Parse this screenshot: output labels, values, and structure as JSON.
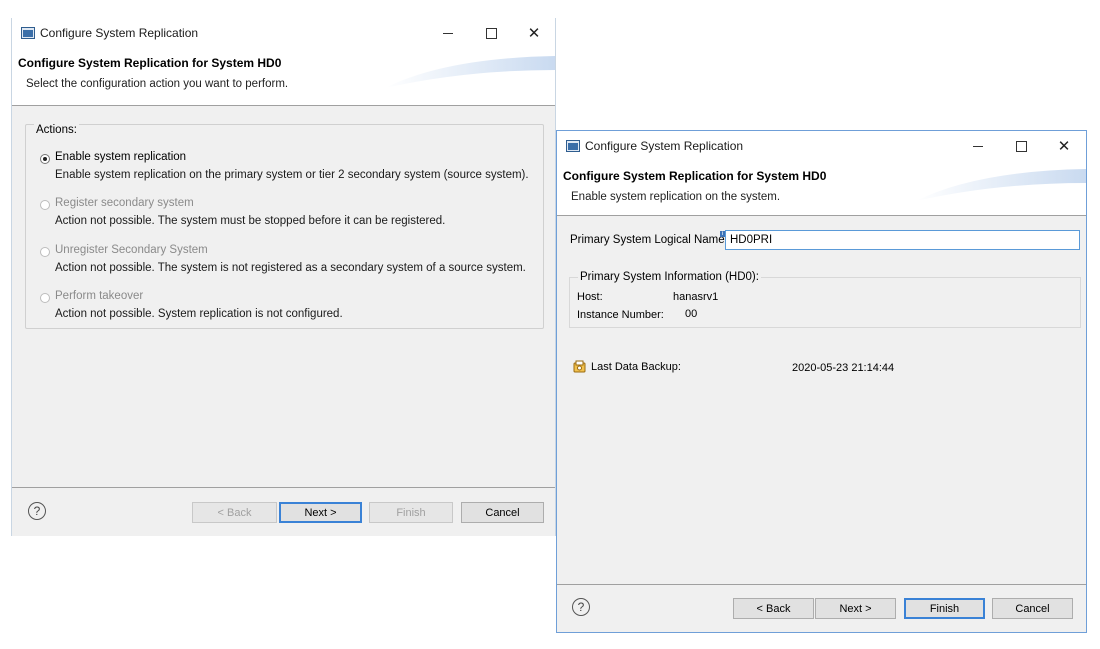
{
  "dialog1": {
    "title": "Configure System Replication",
    "banner_title": "Configure System Replication for System HD0",
    "banner_desc": "Select the configuration action you want to perform.",
    "actions_label": "Actions:",
    "options": [
      {
        "label": "Enable system replication",
        "desc": "Enable system replication on the primary system or tier 2 secondary system (source system).",
        "selected": true,
        "enabled": true
      },
      {
        "label": "Register secondary system",
        "desc": "Action not possible. The system must be stopped before it can be registered.",
        "selected": false,
        "enabled": false
      },
      {
        "label": "Unregister Secondary System",
        "desc": "Action not possible. The system is not registered as a secondary system of a source system.",
        "selected": false,
        "enabled": false
      },
      {
        "label": "Perform takeover",
        "desc": "Action not possible. System replication is not configured.",
        "selected": false,
        "enabled": false
      }
    ],
    "buttons": {
      "back": "< Back",
      "next": "Next >",
      "finish": "Finish",
      "cancel": "Cancel"
    }
  },
  "dialog2": {
    "title": "Configure System Replication",
    "banner_title": "Configure System Replication for System HD0",
    "banner_desc": "Enable system replication on the system.",
    "logical_name_label": "Primary System Logical Name:",
    "logical_name_value": "HD0PRI",
    "info_group_title": "Primary System Information (HD0):",
    "host_label": "Host:",
    "host_value": "hanasrv1",
    "instance_label": "Instance Number:",
    "instance_value": "00",
    "backup_label": "Last Data Backup:",
    "backup_value": "2020-05-23 21:14:44",
    "buttons": {
      "back": "< Back",
      "next": "Next >",
      "finish": "Finish",
      "cancel": "Cancel"
    }
  },
  "icons": {
    "app": "app-window-icon",
    "minimize": "minimize-icon",
    "maximize": "maximize-icon",
    "close": "close-icon",
    "help": "help-icon",
    "backup": "backup-icon",
    "info_decoration": "info-decoration-icon"
  },
  "colors": {
    "dialog_bg": "#f0f0f0",
    "accent_border": "#3a82d6",
    "disabled_text": "#8a8a8a"
  }
}
